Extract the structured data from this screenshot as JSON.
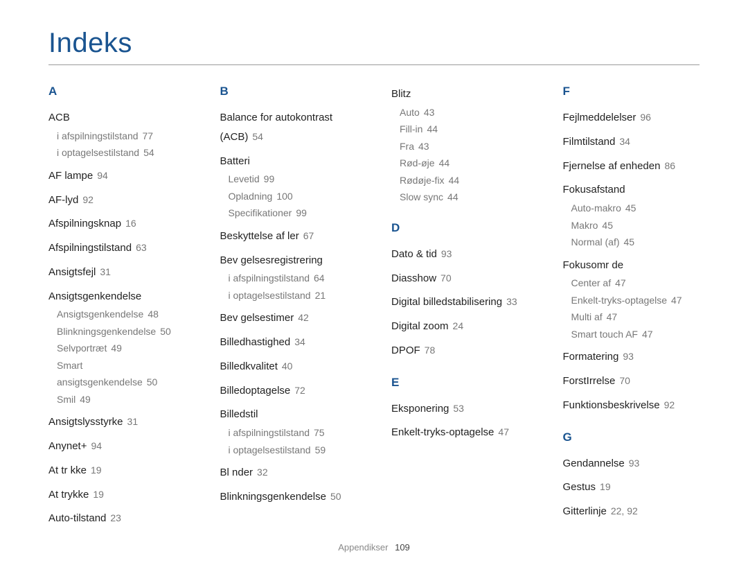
{
  "title": "Indeks",
  "footer_label": "Appendikser",
  "footer_page": "109",
  "columns": [
    [
      {
        "letter": "A",
        "entries": [
          {
            "term": "ACB",
            "subs": [
              {
                "label": "i afspilningstilstand",
                "page": "77"
              },
              {
                "label": "i optagelsestilstand",
                "page": "54"
              }
            ]
          },
          {
            "term": "AF lampe",
            "page": "94"
          },
          {
            "term": "AF-lyd",
            "page": "92"
          },
          {
            "term": "Afspilningsknap",
            "page": "16"
          },
          {
            "term": "Afspilningstilstand",
            "page": "63"
          },
          {
            "term": "Ansigtsfejl",
            "page": "31"
          },
          {
            "term": "Ansigtsgenkendelse",
            "subs": [
              {
                "label": "Ansigtsgenkendelse",
                "page": "48"
              },
              {
                "label": "Blinkningsgenkendelse",
                "page": "50"
              },
              {
                "label": "Selvportræt",
                "page": "49"
              },
              {
                "label": "Smart ansigtsgenkendelse",
                "page": "50"
              },
              {
                "label": "Smil",
                "page": "49"
              }
            ]
          },
          {
            "term": "Ansigtslysstyrke",
            "page": "31"
          },
          {
            "term": "Anynet+",
            "page": "94"
          },
          {
            "term": "At tr kke",
            "page": "19"
          },
          {
            "term": "At trykke",
            "page": "19"
          },
          {
            "term": "Auto-tilstand",
            "page": "23"
          }
        ]
      }
    ],
    [
      {
        "letter": "B",
        "entries": [
          {
            "term": "Balance for autokontrast (ACB)",
            "page": "54"
          },
          {
            "term": "Batteri",
            "subs": [
              {
                "label": "Levetid",
                "page": "99"
              },
              {
                "label": "Opladning",
                "page": "100"
              },
              {
                "label": "Specifikationer",
                "page": "99"
              }
            ]
          },
          {
            "term": "Beskyttelse af  ler",
            "page": "67"
          },
          {
            "term": "Bev gelsesregistrering",
            "subs": [
              {
                "label": "i afspilningstilstand",
                "page": "64"
              },
              {
                "label": "i optagelsestilstand",
                "page": "21"
              }
            ]
          },
          {
            "term": "Bev gelsestimer",
            "page": "42"
          },
          {
            "term": "Billedhastighed",
            "page": "34"
          },
          {
            "term": "Billedkvalitet",
            "page": "40"
          },
          {
            "term": "Billedoptagelse",
            "page": "72"
          },
          {
            "term": "Billedstil",
            "subs": [
              {
                "label": "i afspilningstilstand",
                "page": "75"
              },
              {
                "label": "i optagelsestilstand",
                "page": "59"
              }
            ]
          },
          {
            "term": "Bl nder",
            "page": "32"
          },
          {
            "term": "Blinkningsgenkendelse",
            "page": "50"
          }
        ]
      }
    ],
    [
      {
        "continuation": true,
        "entries": [
          {
            "term": "Blitz",
            "subs": [
              {
                "label": "Auto",
                "page": "43"
              },
              {
                "label": "Fill-in",
                "page": "44"
              },
              {
                "label": "Fra",
                "page": "43"
              },
              {
                "label": "Rød-øje",
                "page": "44"
              },
              {
                "label": "Rødøje-fix",
                "page": "44"
              },
              {
                "label": "Slow sync",
                "page": "44"
              }
            ]
          }
        ]
      },
      {
        "letter": "D",
        "entries": [
          {
            "term": "Dato & tid",
            "page": "93"
          },
          {
            "term": "Diasshow",
            "page": "70"
          },
          {
            "term": "Digital billedstabilisering",
            "page": "33"
          },
          {
            "term": "Digital zoom",
            "page": "24"
          },
          {
            "term": "DPOF",
            "page": "78"
          }
        ]
      },
      {
        "letter": "E",
        "entries": [
          {
            "term": "Eksponering",
            "page": "53"
          },
          {
            "term": "Enkelt-tryks-optagelse",
            "page": "47"
          }
        ]
      }
    ],
    [
      {
        "letter": "F",
        "entries": [
          {
            "term": "Fejlmeddelelser",
            "page": "96"
          },
          {
            "term": "Filmtilstand",
            "page": "34"
          },
          {
            "term": "Fjernelse af enheden",
            "page": "86"
          },
          {
            "term": "Fokusafstand",
            "subs": [
              {
                "label": "Auto-makro",
                "page": "45"
              },
              {
                "label": "Makro",
                "page": "45"
              },
              {
                "label": "Normal (af)",
                "page": "45"
              }
            ]
          },
          {
            "term": "Fokusomr de",
            "subs": [
              {
                "label": "Center af",
                "page": "47"
              },
              {
                "label": "Enkelt-tryks-optagelse",
                "page": "47"
              },
              {
                "label": "Multi af",
                "page": "47"
              },
              {
                "label": "Smart touch AF",
                "page": "47"
              }
            ]
          },
          {
            "term": "Formatering",
            "page": "93"
          },
          {
            "term": "ForstIrrelse",
            "page": "70"
          },
          {
            "term": "Funktionsbeskrivelse",
            "page": "92"
          }
        ]
      },
      {
        "letter": "G",
        "entries": [
          {
            "term": "Gendannelse",
            "page": "93"
          },
          {
            "term": "Gestus",
            "page": "19"
          },
          {
            "term": "Gitterlinje",
            "page": "22, 92"
          }
        ]
      }
    ]
  ]
}
